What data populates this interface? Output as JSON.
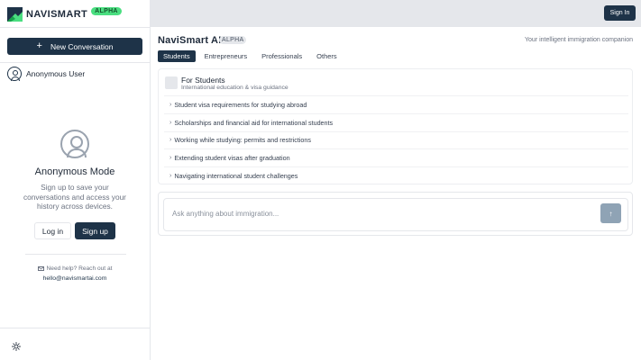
{
  "brand": {
    "name": "NAVISMART",
    "badge": "ALPHA"
  },
  "sidebar": {
    "new_conversation": "New Conversation",
    "user_name": "Anonymous User",
    "anon_title": "Anonymous Mode",
    "anon_desc": "Sign up to save your conversations and access your history across devices.",
    "login": "Log in",
    "signup": "Sign up",
    "help_text": "Need help? Reach out at",
    "help_email": "hello@navismartai.com"
  },
  "topbar": {
    "signin": "Sign In"
  },
  "main": {
    "title": "NaviSmart AI",
    "badge": "ALPHA",
    "tagline": "Your intelligent immigration companion",
    "tabs": [
      "Students",
      "Entrepreneurs",
      "Professionals",
      "Others"
    ],
    "active_tab": "Students",
    "card": {
      "title": "For Students",
      "subtitle": "International education & visa guidance",
      "items": [
        "Student visa requirements for studying abroad",
        "Scholarships and financial aid for international students",
        "Working while studying: permits and restrictions",
        "Extending student visas after graduation",
        "Navigating international student challenges"
      ]
    },
    "composer": {
      "placeholder": "Ask anything about immigration..."
    }
  },
  "colors": {
    "primary": "#1e3348",
    "alpha_badge": "#4ade80",
    "topbar_bg": "#e5e7eb"
  },
  "icons": {
    "logo": "navismart-logo",
    "user": "user-circle-icon",
    "mail": "mail-icon",
    "theme": "sun-icon",
    "send": "arrow-up-icon",
    "plus": "plus-icon"
  }
}
